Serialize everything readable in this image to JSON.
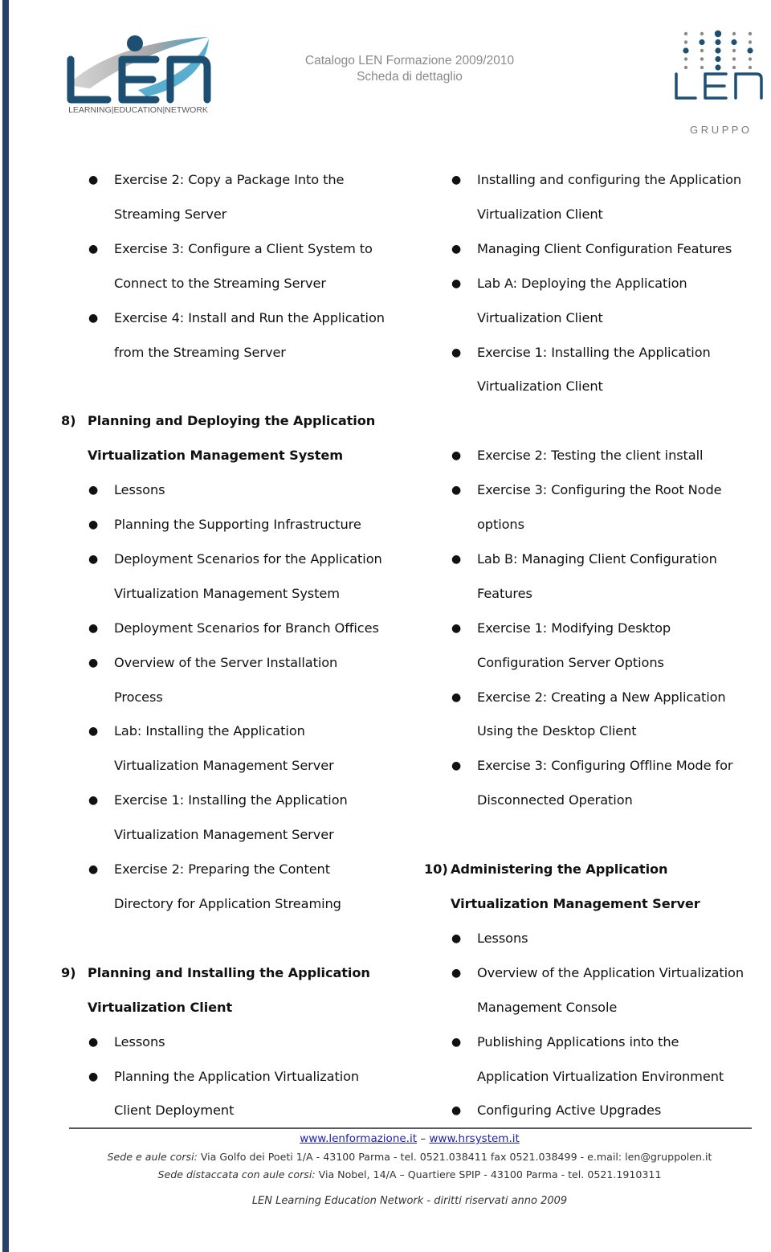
{
  "header": {
    "title_line1": "Catalogo LEN Formazione 2009/2010",
    "title_line2": "Scheda di dettaglio",
    "logo_left_tagline": "LEARNING|EDUCATION|NETWORK",
    "logo_right_word": "LEN",
    "logo_right_tagline": "G R U P P O"
  },
  "colors": {
    "brand_dark_blue": "#1d4f73",
    "brand_light_blue": "#3aa0c8",
    "brand_grey": "#8a8a8a",
    "side_bar": "#25406a"
  },
  "left_column": {
    "top_items": [
      {
        "line1": "Exercise 2: Copy a Package Into the",
        "line2": "Streaming Server"
      },
      {
        "line1": "Exercise 3: Configure a Client System to",
        "line2": "Connect to the Streaming Server"
      },
      {
        "line1": "Exercise 4: Install and Run the Application",
        "line2": "from the Streaming Server"
      }
    ],
    "section8": {
      "number": "8)",
      "title_line1": "Planning and Deploying the Application",
      "title_line2": "Virtualization Management System",
      "items": [
        {
          "line1": "Lessons",
          "line2": ""
        },
        {
          "line1": "Planning the Supporting Infrastructure",
          "line2": ""
        },
        {
          "line1": "Deployment Scenarios for the Application",
          "line2": "Virtualization Management System"
        },
        {
          "line1": "Deployment Scenarios for Branch Offices",
          "line2": ""
        },
        {
          "line1": "Overview of the Server Installation",
          "line2": "Process"
        },
        {
          "line1": "Lab: Installing the Application",
          "line2": "Virtualization Management Server"
        },
        {
          "line1": "Exercise 1: Installing the Application",
          "line2": "Virtualization Management Server"
        },
        {
          "line1": "Exercise 2: Preparing the Content",
          "line2": "Directory for Application Streaming"
        }
      ]
    },
    "section9": {
      "number": "9)",
      "title_line1": "Planning and Installing the Application",
      "title_line2": "Virtualization Client",
      "items": [
        {
          "line1": "Lessons",
          "line2": ""
        },
        {
          "line1": "Planning the Application Virtualization",
          "line2": "Client Deployment"
        }
      ]
    }
  },
  "right_column": {
    "top_items": [
      {
        "line1": "Installing and configuring the Application",
        "line2": "Virtualization Client"
      },
      {
        "line1": "Managing Client Configuration Features",
        "line2": ""
      },
      {
        "line1": "Lab A: Deploying the Application",
        "line2": "Virtualization Client"
      },
      {
        "line1": "Exercise 1: Installing the Application",
        "line2": "Virtualization Client"
      }
    ],
    "mid_items": [
      {
        "line1": "Exercise 2: Testing the client install",
        "line2": ""
      },
      {
        "line1": "Exercise 3: Configuring the Root Node",
        "line2": "options"
      },
      {
        "line1": "Lab B: Managing Client Configuration",
        "line2": "Features"
      },
      {
        "line1": "Exercise 1: Modifying Desktop",
        "line2": "Configuration Server Options"
      },
      {
        "line1": "Exercise 2: Creating a New Application",
        "line2": "Using the Desktop Client"
      },
      {
        "line1": "Exercise 3: Configuring Offline Mode for",
        "line2": "Disconnected Operation"
      }
    ],
    "section10": {
      "number": "10)",
      "title_line1": "Administering the Application",
      "title_line2": "Virtualization Management Server",
      "items": [
        {
          "line1": "Lessons",
          "line2": ""
        },
        {
          "line1": "Overview of the Application Virtualization",
          "line2": "Management Console"
        },
        {
          "line1": "Publishing Applications into the",
          "line2": "Application Virtualization Environment"
        },
        {
          "line1": "Configuring Active Upgrades",
          "line2": ""
        }
      ]
    }
  },
  "footer": {
    "link1": "www.lenformazione.it",
    "separator": " – ",
    "link2": "www.hrsystem.it",
    "line1_label": "Sede e aule corsi:",
    "line1_text": " Via Golfo dei Poeti 1/A - 43100 Parma -  tel. 0521.038411 fax 0521.038499 - e.mail: len@gruppolen.it",
    "line2_label": "Sede distaccata con aule corsi:",
    "line2_text": " Via  Nobel, 14/A – Quartiere SPIP - 43100 Parma - tel. 0521.1910311",
    "copyright": "LEN Learning Education Network  - diritti riservati anno 2009"
  }
}
